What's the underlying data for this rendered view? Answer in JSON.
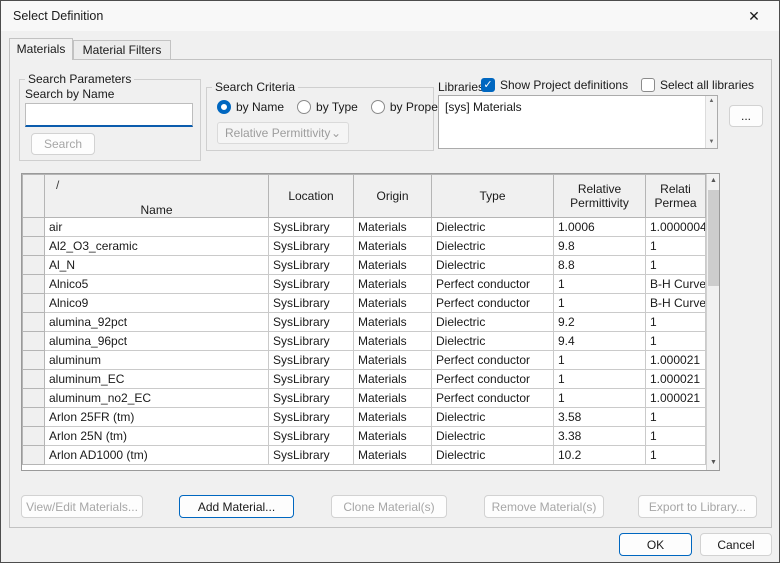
{
  "dialog": {
    "title": "Select Definition",
    "close_glyph": "✕"
  },
  "tabs": [
    {
      "label": "Materials",
      "active": true
    },
    {
      "label": "Material Filters",
      "active": false
    }
  ],
  "search_parameters": {
    "group_label": "Search Parameters",
    "name_label": "Search by Name",
    "input_value": "",
    "search_button_label": "Search",
    "search_enabled": false
  },
  "search_criteria": {
    "group_label": "Search Criteria",
    "radios": [
      {
        "label": "by Name",
        "selected": true
      },
      {
        "label": "by Type",
        "selected": false
      },
      {
        "label": "by Property",
        "selected": false
      }
    ],
    "property_select_value": "Relative Permittivity",
    "property_select_enabled": false,
    "dropdown_glyph": "⌄"
  },
  "libraries": {
    "label": "Libraries",
    "checkboxes": [
      {
        "label": "Show Project definitions",
        "checked": true
      },
      {
        "label": "Select all libraries",
        "checked": false
      }
    ],
    "check_glyph": "✓",
    "items": [
      "[sys] Materials"
    ],
    "browse_button_label": "...",
    "scroll_up_glyph": "▲",
    "scroll_down_glyph": "▼"
  },
  "table": {
    "sort_indicator": "/",
    "columns": [
      {
        "label": "Name"
      },
      {
        "label": "Location"
      },
      {
        "label": "Origin"
      },
      {
        "label": "Type"
      },
      {
        "label": "Relative\nPermittivity"
      },
      {
        "label": "Relati\nPermea"
      }
    ],
    "column_keys": [
      "name",
      "location",
      "origin",
      "type",
      "relative-permittivity",
      "relative-permeability"
    ],
    "rows": [
      [
        "air",
        "SysLibrary",
        "Materials",
        "Dielectric",
        "1.0006",
        "1.0000004"
      ],
      [
        "Al2_O3_ceramic",
        "SysLibrary",
        "Materials",
        "Dielectric",
        "9.8",
        "1"
      ],
      [
        "Al_N",
        "SysLibrary",
        "Materials",
        "Dielectric",
        "8.8",
        "1"
      ],
      [
        "Alnico5",
        "SysLibrary",
        "Materials",
        "Perfect conductor",
        "1",
        "B-H Curve..."
      ],
      [
        "Alnico9",
        "SysLibrary",
        "Materials",
        "Perfect conductor",
        "1",
        "B-H Curve..."
      ],
      [
        "alumina_92pct",
        "SysLibrary",
        "Materials",
        "Dielectric",
        "9.2",
        "1"
      ],
      [
        "alumina_96pct",
        "SysLibrary",
        "Materials",
        "Dielectric",
        "9.4",
        "1"
      ],
      [
        "aluminum",
        "SysLibrary",
        "Materials",
        "Perfect conductor",
        "1",
        "1.000021"
      ],
      [
        "aluminum_EC",
        "SysLibrary",
        "Materials",
        "Perfect conductor",
        "1",
        "1.000021"
      ],
      [
        "aluminum_no2_EC",
        "SysLibrary",
        "Materials",
        "Perfect conductor",
        "1",
        "1.000021"
      ],
      [
        "Arlon 25FR (tm)",
        "SysLibrary",
        "Materials",
        "Dielectric",
        "3.58",
        "1"
      ],
      [
        "Arlon 25N (tm)",
        "SysLibrary",
        "Materials",
        "Dielectric",
        "3.38",
        "1"
      ],
      [
        "Arlon AD1000 (tm)",
        "SysLibrary",
        "Materials",
        "Dielectric",
        "10.2",
        "1"
      ]
    ],
    "scroll_up_glyph": "▲",
    "scroll_down_glyph": "▼"
  },
  "actions": [
    {
      "label": "View/Edit Materials...",
      "enabled": false
    },
    {
      "label": "Add Material...",
      "enabled": true,
      "default": true
    },
    {
      "label": "Clone Material(s)",
      "enabled": false
    },
    {
      "label": "Remove Material(s)",
      "enabled": false
    },
    {
      "label": "Export to Library...",
      "enabled": false
    }
  ],
  "footer": {
    "ok_label": "OK",
    "cancel_label": "Cancel"
  },
  "colors": {
    "accent": "#0067c0",
    "focus_underline": "#0b5cad",
    "dialog_bg": "#f0f0f0"
  }
}
